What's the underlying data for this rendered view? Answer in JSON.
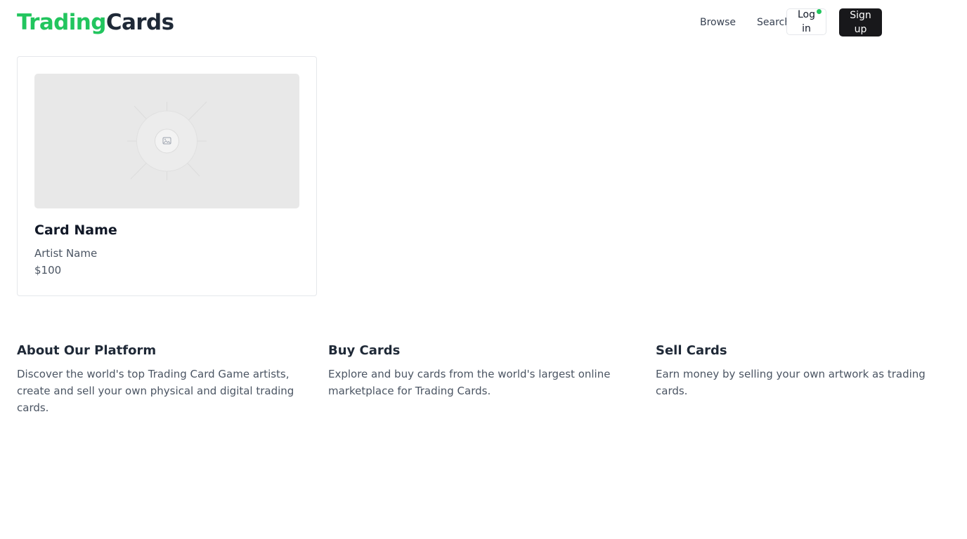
{
  "header": {
    "logo_part1": "Trading",
    "logo_part2": "Cards",
    "nav": {
      "browse": "Browse",
      "search": "Search"
    },
    "login_label": "Log in",
    "signup_label": "Sign up"
  },
  "card": {
    "image_icon": "image-placeholder-icon",
    "name": "Card Name",
    "artist": "Artist Name",
    "price": "$100"
  },
  "info": {
    "about": {
      "title": "About Our Platform",
      "text": "Discover the world's top Trading Card Game artists, create and sell your own physical and digital trading cards."
    },
    "buy": {
      "title": "Buy Cards",
      "text": "Explore and buy cards from the world's largest online marketplace for Trading Cards."
    },
    "sell": {
      "title": "Sell Cards",
      "text": "Earn money by selling your own artwork as trading cards."
    }
  },
  "colors": {
    "brand_green": "#22c55e",
    "dark": "#1f2937",
    "signup_bg": "#18181b",
    "notification_dot": "#22c55e"
  }
}
